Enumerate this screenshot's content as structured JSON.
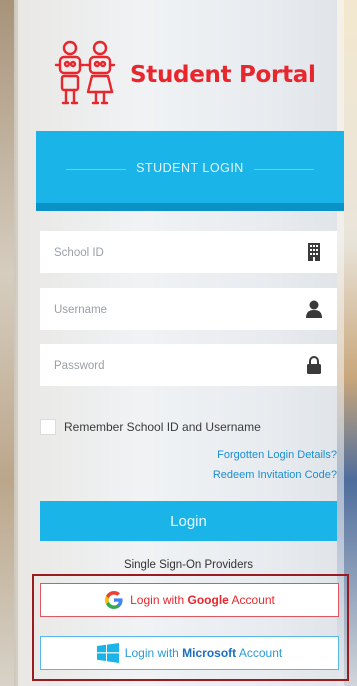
{
  "brand": {
    "title": "Student Portal",
    "logo_icon": "robot-students-icon",
    "color": "#e8262d"
  },
  "header": {
    "title": "STUDENT LOGIN",
    "color": "#1ab4e8"
  },
  "fields": {
    "school_id": {
      "placeholder": "School ID",
      "value": "",
      "icon": "building-icon"
    },
    "username": {
      "placeholder": "Username",
      "value": "",
      "icon": "user-icon"
    },
    "password": {
      "placeholder": "Password",
      "value": "",
      "icon": "lock-icon"
    }
  },
  "remember": {
    "label": "Remember School ID and Username",
    "checked": false
  },
  "links": {
    "forgotten": "Forgotten Login Details?",
    "redeem": "Redeem Invitation Code?"
  },
  "login_button": {
    "label": "Login"
  },
  "sso": {
    "label": "Single Sign-On Providers",
    "google": {
      "prefix": "Login with ",
      "provider": "Google",
      "suffix": " Account",
      "icon": "google-icon"
    },
    "microsoft": {
      "prefix": "Login with ",
      "provider": "Microsoft",
      "suffix": " Account",
      "icon": "windows-icon"
    },
    "highlight_color": "#9b1c20"
  }
}
